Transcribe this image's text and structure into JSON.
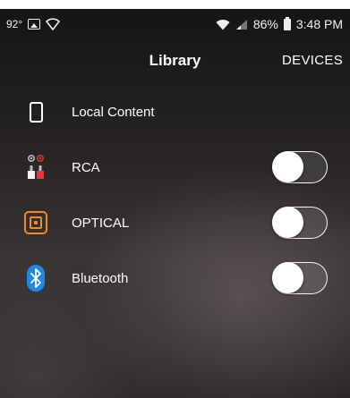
{
  "status_bar": {
    "temperature": "92°",
    "battery": "86%",
    "time": "3:48 PM"
  },
  "header": {
    "title": "Library",
    "devices_label": "DEVICES"
  },
  "sources": [
    {
      "label": "Local Content",
      "icon": "phone-icon",
      "has_toggle": false
    },
    {
      "label": "RCA",
      "icon": "rca-icon",
      "has_toggle": true,
      "enabled": false
    },
    {
      "label": "OPTICAL",
      "icon": "optical-icon",
      "has_toggle": true,
      "enabled": false
    },
    {
      "label": "Bluetooth",
      "icon": "bluetooth-icon",
      "has_toggle": true,
      "enabled": false
    }
  ],
  "colors": {
    "optical_accent": "#f08a24",
    "bluetooth_blue": "#1e88e5",
    "rca_red": "#e53935"
  }
}
